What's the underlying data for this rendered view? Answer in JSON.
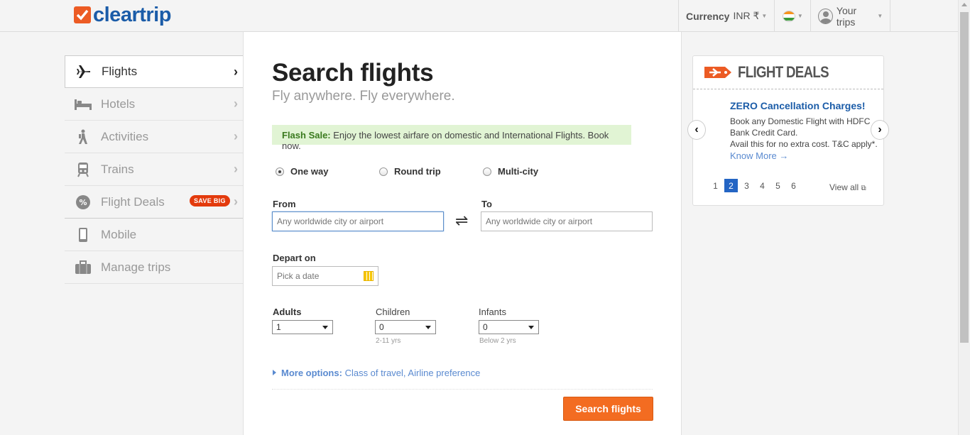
{
  "header": {
    "logo_text": "cleartrip",
    "currency_label": "Currency",
    "currency_value": "INR ₹",
    "trips_label": "Your trips"
  },
  "nav": {
    "items": [
      {
        "label": "Flights",
        "icon": "plane-icon"
      },
      {
        "label": "Hotels",
        "icon": "bed-icon"
      },
      {
        "label": "Activities",
        "icon": "hiker-icon"
      },
      {
        "label": "Trains",
        "icon": "train-icon"
      },
      {
        "label": "Flight Deals",
        "icon": "percent-badge-icon",
        "badge": "SAVE BIG"
      },
      {
        "label": "Mobile",
        "icon": "mobile-icon"
      },
      {
        "label": "Manage trips",
        "icon": "briefcase-icon"
      }
    ]
  },
  "search": {
    "title": "Search flights",
    "subtitle": "Fly anywhere. Fly everywhere.",
    "flash_label": "Flash Sale:",
    "flash_text": "Enjoy the lowest airfare on domestic and International Flights. Book now.",
    "trip_types": [
      "One way",
      "Round trip",
      "Multi-city"
    ],
    "selected_trip_type": "One way",
    "from_label": "From",
    "from_placeholder": "Any worldwide city or airport",
    "to_label": "To",
    "to_placeholder": "Any worldwide city or airport",
    "depart_label": "Depart on",
    "depart_placeholder": "Pick a date",
    "adults_label": "Adults",
    "adults_value": "1",
    "children_label": "Children",
    "children_value": "0",
    "children_hint": "2-11 yrs",
    "infants_label": "Infants",
    "infants_value": "0",
    "infants_hint": "Below 2 yrs",
    "more_options_label": "More options:",
    "more_options_text": "Class of travel, Airline preference",
    "submit_label": "Search flights"
  },
  "deals": {
    "title": "FLIGHT DEALS",
    "deal_title": "ZERO Cancellation Charges!",
    "deal_line1": "Book any Domestic Flight with HDFC Bank Credit Card.",
    "deal_line2": "Avail this for no extra cost. T&C apply*.",
    "deal_link": "Know More →",
    "pages": [
      "1",
      "2",
      "3",
      "4",
      "5",
      "6"
    ],
    "current_page": "2",
    "view_all": "View all"
  },
  "colors": {
    "brand_blue": "#1b5ca8",
    "brand_orange": "#f36c21",
    "flash_bg": "#e1f4d4",
    "link_blue": "#5a8ad0"
  }
}
